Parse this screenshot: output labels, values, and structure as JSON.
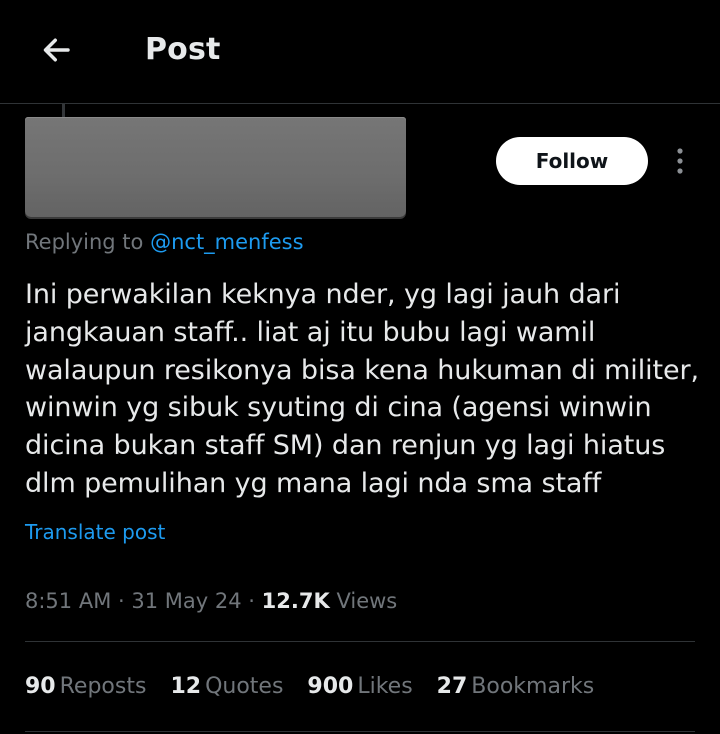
{
  "header": {
    "title": "Post",
    "back_icon": "arrow-left-icon"
  },
  "author": {
    "follow_label": "Follow",
    "more_icon": "more-vertical-icon"
  },
  "reply": {
    "prefix": "Replying to",
    "mention": "@nct_menfess"
  },
  "post": {
    "text": "Ini perwakilan keknya nder, yg lagi jauh dari\njangkauan staff.. liat aj itu bubu lagi wamil\nwalaupun resikonya bisa kena hukuman di militer,\nwinwin yg sibuk syuting di cina (agensi winwin\ndicina bukan staff SM) dan renjun yg lagi hiatus\ndlm pemulihan yg mana lagi nda sma staff",
    "translate_label": "Translate post",
    "time": "8:51 AM",
    "date": "31 May 24",
    "views_count": "12.7K",
    "views_label": "Views"
  },
  "stats": {
    "reposts": {
      "count": "90",
      "label": "Reposts"
    },
    "quotes": {
      "count": "12",
      "label": "Quotes"
    },
    "likes": {
      "count": "900",
      "label": "Likes"
    },
    "bookmarks": {
      "count": "27",
      "label": "Bookmarks"
    }
  },
  "colors": {
    "background": "#000000",
    "text": "#e7e9ea",
    "secondary": "#71767b",
    "accent": "#1d9bf0",
    "divider": "#2f3336"
  }
}
